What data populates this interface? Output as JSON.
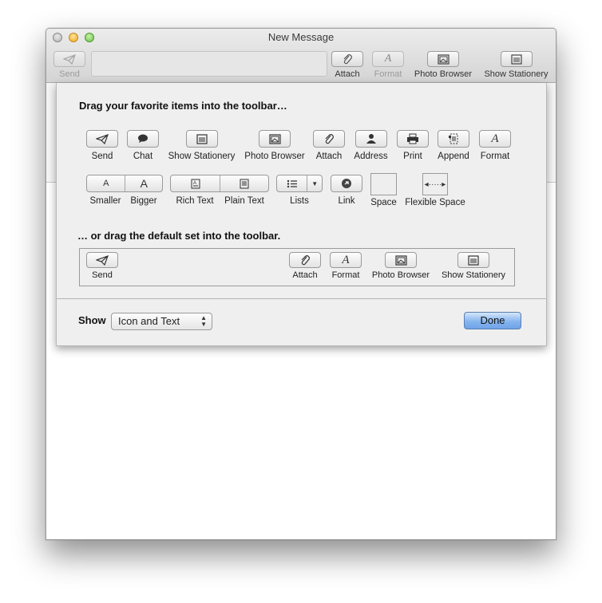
{
  "window": {
    "title": "New Message"
  },
  "toolbar": {
    "send": "Send",
    "attach": "Attach",
    "format": "Format",
    "photo_browser": "Photo Browser",
    "show_stationery": "Show Stationery"
  },
  "sheet": {
    "heading_favorites": "Drag your favorite items into the toolbar…",
    "heading_default": "… or drag the default set into the toolbar.",
    "palette_row1": [
      "Send",
      "Chat",
      "Show Stationery",
      "Photo Browser",
      "Attach",
      "Address",
      "Print",
      "Append",
      "Format"
    ],
    "palette_row2": {
      "smaller": "Smaller",
      "bigger": "Bigger",
      "rich_text": "Rich Text",
      "plain_text": "Plain Text",
      "lists": "Lists",
      "link": "Link",
      "space": "Space",
      "flexible_space": "Flexible Space"
    },
    "default_set": [
      "Send",
      "Attach",
      "Format",
      "Photo Browser",
      "Show Stationery"
    ],
    "show_label": "Show",
    "show_value": "Icon and Text",
    "done": "Done"
  },
  "colors": {
    "done_button": "#86b5ee",
    "sheet_bg": "#eeeeee"
  }
}
